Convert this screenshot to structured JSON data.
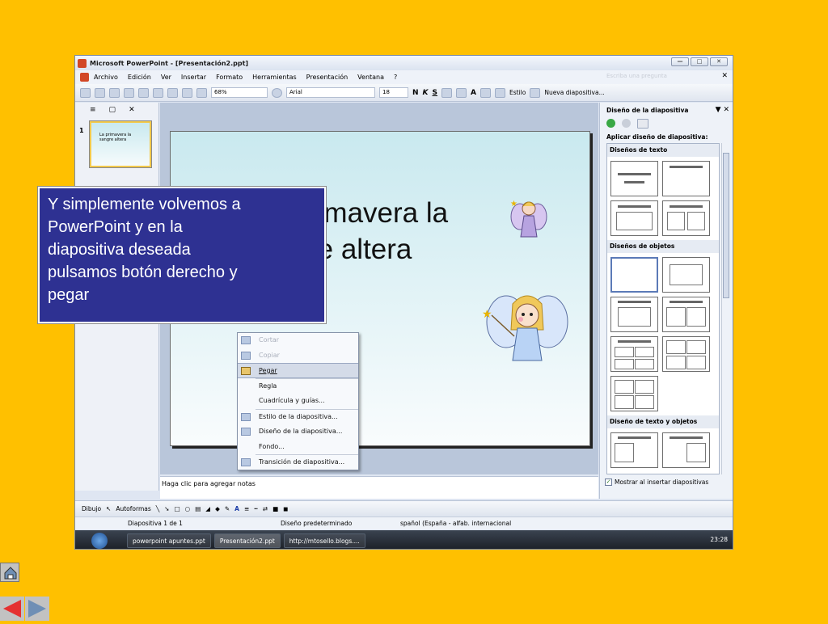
{
  "window": {
    "title": "Microsoft PowerPoint - [Presentación2.ppt]",
    "controls": [
      "—",
      "□",
      "✕"
    ]
  },
  "menubar": {
    "items": [
      "Archivo",
      "Edición",
      "Ver",
      "Insertar",
      "Formato",
      "Herramientas",
      "Presentación",
      "Ventana",
      "?"
    ],
    "ask_placeholder": "Escriba una pregunta"
  },
  "toolbar": {
    "zoom": "68%",
    "font": "Arial",
    "font_size": "18",
    "bold": "N",
    "italic": "K",
    "underline": "S",
    "style_label": "Estilo",
    "new_slide_label": "Nueva diapositiva..."
  },
  "left_panel": {
    "slide_number": "1",
    "thumb_text": "La primavera la sangre altera"
  },
  "slide": {
    "title_visible": "rimavera la\nre altera"
  },
  "context_menu": {
    "items": [
      {
        "label": "Cortar",
        "enabled": false,
        "icon": "scissors-icon"
      },
      {
        "label": "Copiar",
        "enabled": false,
        "icon": "copy-icon"
      },
      {
        "label": "Pegar",
        "enabled": true,
        "icon": "paste-icon",
        "highlighted": true
      },
      {
        "label": "Regla",
        "enabled": true,
        "icon": ""
      },
      {
        "label": "Cuadrícula y guías...",
        "enabled": true,
        "icon": ""
      },
      {
        "label": "Estilo de la diapositiva...",
        "enabled": true,
        "icon": "style-icon"
      },
      {
        "label": "Diseño de la diapositiva...",
        "enabled": true,
        "icon": "layout-icon"
      },
      {
        "label": "Fondo...",
        "enabled": true,
        "icon": ""
      },
      {
        "label": "Transición de diapositiva...",
        "enabled": true,
        "icon": "transition-icon"
      }
    ]
  },
  "notes": {
    "placeholder": "Haga clic para agregar notas"
  },
  "task_pane": {
    "title": "Diseño de la diapositiva",
    "apply_label": "Aplicar diseño de diapositiva:",
    "sections": {
      "text": "Diseños de texto",
      "objects": "Diseños de objetos",
      "text_objects": "Diseño de texto y objetos"
    },
    "show_on_insert": "Mostrar al insertar diapositivas"
  },
  "drawbar": {
    "draw_label": "Dibujo",
    "autoshapes_label": "Autoformas"
  },
  "statusbar": {
    "slide_count": "Diapositiva 1 de 1",
    "design": "Diseño predeterminado",
    "language": "spañol (España - alfab. internacional"
  },
  "taskbar": {
    "tasks": [
      "powerpoint apuntes.ppt",
      "Presentación2.ppt",
      "http://mtosello.blogs...."
    ],
    "clock": "23:28"
  },
  "callout": {
    "text": "Y simplemente volvemos a\nPowerPoint y en la\ndiapositiva deseada\npulsamos botón derecho y\npegar"
  },
  "colors": {
    "background": "#FFC000",
    "callout": "#2e3192"
  }
}
